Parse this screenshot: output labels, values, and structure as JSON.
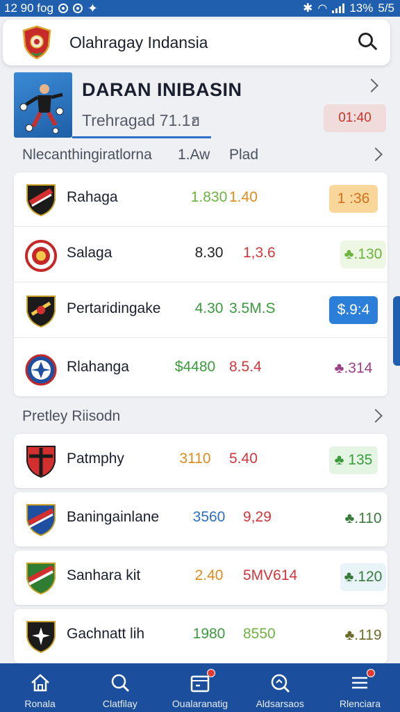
{
  "status_bar": {
    "time": "12 90 fog",
    "battery": "13%",
    "right_text": "5/5"
  },
  "header": {
    "title": "Olahragay Indansia"
  },
  "featured": {
    "title": "DARAN INIBASIN",
    "subtitle": "Trehragad 71.1ฮ",
    "badge": "01:40"
  },
  "section1": {
    "title": "Nlecanthingiratlorna",
    "col1": "1.Aw",
    "col2": "Plad",
    "rows": [
      {
        "name": "Rahaga",
        "v1": "1.830",
        "v2": "1.40",
        "badge": "1 :36",
        "v1_color": "#6db33f",
        "v2_color": "#e08a1c",
        "badge_bg": "#f9d79a",
        "badge_fg": "#d2701b"
      },
      {
        "name": "Salaga",
        "v1": "8.30",
        "v2": "1,3.6",
        "badge": "♣.130",
        "v1_color": "#222222",
        "v2_color": "#d0363a",
        "badge_bg": "#eef7e4",
        "badge_fg": "#6db33f"
      },
      {
        "name": "Pertaridingake",
        "v1": "4.30",
        "v2": "3.5M.S",
        "badge": "$.9:4",
        "v1_color": "#3a9a3c",
        "v2_color": "#3a9a3c",
        "badge_bg": "#2c7fd8",
        "badge_fg": "#ffffff"
      },
      {
        "name": "Rlahanga",
        "v1": "$4480",
        "v2": "8.5.4",
        "badge": "♣.314",
        "v1_color": "#3a9a3c",
        "v2_color": "#d0363a",
        "badge_bg": "#ffffff",
        "badge_fg": "#9a3f86"
      }
    ]
  },
  "section2": {
    "title": "Pretley Riisodn",
    "rows": [
      {
        "name": "Patmphy",
        "v1": "3110",
        "v2": "5.40",
        "badge": "♣ 135",
        "v1_color": "#e08a1c",
        "v2_color": "#d0363a",
        "badge_bg": "#e4f5e4",
        "badge_fg": "#3a9a3c"
      },
      {
        "name": "Baningainlane",
        "v1": "3560",
        "v2": "9,29",
        "badge": "♣.110",
        "v1_color": "#2c6fc0",
        "v2_color": "#d0363a",
        "badge_bg": "#ffffff",
        "badge_fg": "#3a7a3c"
      },
      {
        "name": "Sanhara kit",
        "v1": "2.40",
        "v2": "5MV614",
        "badge": "♣.120",
        "v1_color": "#e08a1c",
        "v2_color": "#d0363a",
        "badge_bg": "#e8f4f8",
        "badge_fg": "#3a7a3c"
      },
      {
        "name": "Gachnatt lih",
        "v1": "1980",
        "v2": "8550",
        "badge": "♣.119",
        "v1_color": "#3a9a3c",
        "v2_color": "#6db33f",
        "badge_bg": "#ffffff",
        "badge_fg": "#6b6b2a"
      }
    ]
  },
  "bottom_nav": [
    {
      "label": "Ronala",
      "icon": "home-icon"
    },
    {
      "label": "Clatfilay",
      "icon": "search-icon"
    },
    {
      "label": "Oualaranatig",
      "icon": "calendar-icon"
    },
    {
      "label": "Aldsarsaos",
      "icon": "stats-search-icon"
    },
    {
      "label": "Rlenciara",
      "icon": "menu-icon"
    }
  ]
}
